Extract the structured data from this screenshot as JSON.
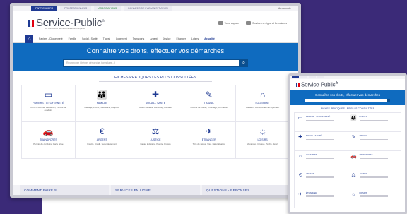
{
  "top_tabs": [
    {
      "label": "PARTICULIERS",
      "active": true
    },
    {
      "label": "PROFESSIONNELS",
      "active": false
    },
    {
      "label": "ASSOCIATIONS",
      "active": false
    },
    {
      "label": "DONNEES DE L'ADMINISTRATION",
      "active": false
    }
  ],
  "account_label": "Mon compte",
  "logo": {
    "name": "Service-Public",
    "suffix": ".fr",
    "tagline": "Le site officiel de l'administration française"
  },
  "header_items": [
    "Votre espace",
    "Services en ligne et formulaires"
  ],
  "nav": {
    "items": [
      "Papiers - Citoyenneté",
      "Famille",
      "Social - Santé",
      "Travail",
      "Logement",
      "Transports",
      "Argent",
      "Justice",
      "Etranger",
      "Loisirs",
      "Actualité"
    ]
  },
  "banner": {
    "title": "Connaître vos droits, effectuer vos démarches",
    "search_placeholder": "Rechercher (thème, démarche, formulaire...)"
  },
  "section_title": "FICHES PRATIQUES LES PLUS CONSULTÉES",
  "cards": [
    {
      "icon": "id-card-icon",
      "glyph": "▭",
      "title": "Papiers - Citoyenneté",
      "desc": "Carte d'identité, Passeport, Permis de conduire"
    },
    {
      "icon": "family-icon",
      "glyph": "👪",
      "title": "Famille",
      "desc": "Mariage, PACS, Naissance, Adoption"
    },
    {
      "icon": "health-icon",
      "glyph": "✚",
      "title": "Social - Santé",
      "desc": "Aides sociales, Handicap, Retraite"
    },
    {
      "icon": "work-icon",
      "glyph": "✎",
      "title": "Travail",
      "desc": "Contrat de travail, Chômage, Formation"
    },
    {
      "icon": "house-icon",
      "glyph": "⌂",
      "title": "Logement",
      "desc": "Location, Achat, Aides au logement"
    },
    {
      "icon": "car-icon",
      "glyph": "🚗",
      "title": "Transports",
      "desc": "Permis de conduire, Carte grise"
    },
    {
      "icon": "money-icon",
      "glyph": "€",
      "title": "Argent",
      "desc": "Impôts, Crédit, Surendettement"
    },
    {
      "icon": "justice-icon",
      "glyph": "⚖",
      "title": "Justice",
      "desc": "Casier judiciaire, Plainte, Procès"
    },
    {
      "icon": "passport-icon",
      "glyph": "✈",
      "title": "Étranger",
      "desc": "Titre de séjour, Visa, Naturalisation"
    },
    {
      "icon": "palm-icon",
      "glyph": "☼",
      "title": "Loisirs",
      "desc": "Vacances, Chasse, Pêche, Sport"
    }
  ],
  "bottom_sections": [
    "COMMENT FAIRE SI...",
    "SERVICES EN LIGNE",
    "QUESTIONS - RÉPONSES"
  ],
  "side": {
    "banner_title": "Connaître vos droits, effectuer vos démarches",
    "section_title": "FICHES PRATIQUES LES PLUS CONSULTÉES",
    "cards": [
      {
        "glyph": "▭",
        "title": "Papiers - Citoyenneté"
      },
      {
        "glyph": "👪",
        "title": "Famille"
      },
      {
        "glyph": "✚",
        "title": "Social - Santé"
      },
      {
        "glyph": "✎",
        "title": "Travail"
      },
      {
        "glyph": "⌂",
        "title": "Logement"
      },
      {
        "glyph": "🚗",
        "title": "Transports"
      },
      {
        "glyph": "€",
        "title": "Argent"
      },
      {
        "glyph": "⚖",
        "title": "Justice"
      },
      {
        "glyph": "✈",
        "title": "Étranger"
      },
      {
        "glyph": "☼",
        "title": "Loisirs"
      }
    ]
  }
}
